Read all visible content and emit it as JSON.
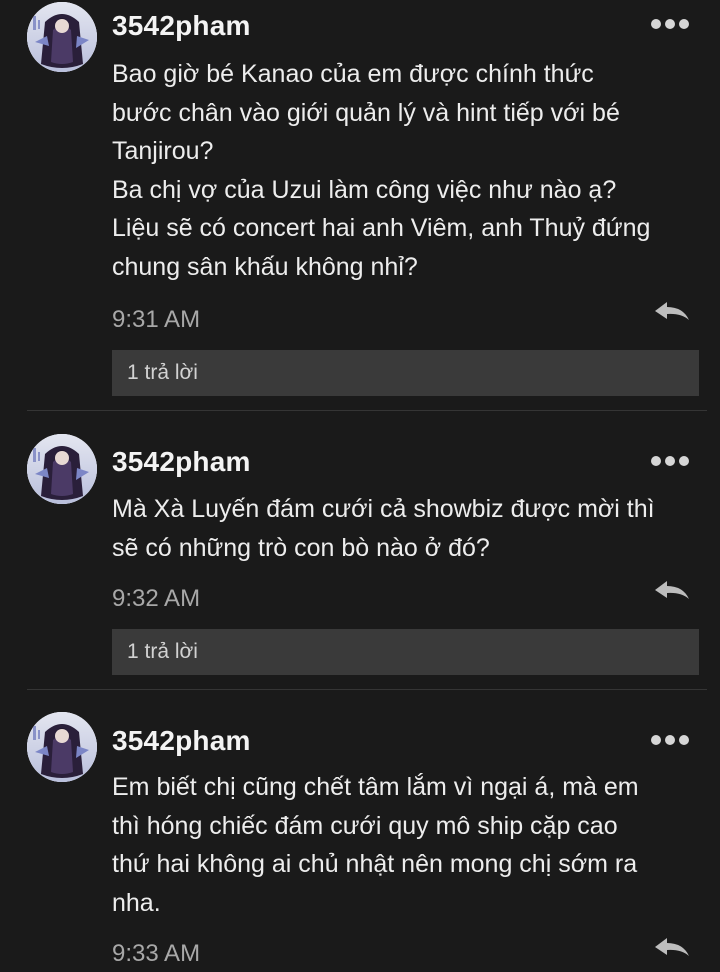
{
  "comments": [
    {
      "username": "3542pham",
      "lines": [
        "Bao giờ bé Kanao của em được chính thức",
        "bước chân vào giới quản lý và hint tiếp với bé",
        "Tanjirou?",
        "Ba chị vợ của Uzui làm công việc như nào ạ?",
        "Liệu sẽ có concert hai anh Viêm, anh Thuỷ đứng",
        "chung sân khấu không nhỉ?"
      ],
      "time": "9:31 AM",
      "replies_label": "1 trả lời"
    },
    {
      "username": "3542pham",
      "lines": [
        "Mà Xà Luyến đám cưới cả showbiz được mời thì",
        "sẽ có những trò con bò nào ở đó?"
      ],
      "time": "9:32 AM",
      "replies_label": "1 trả lời"
    },
    {
      "username": "3542pham",
      "lines": [
        "Em biết chị cũng chết tâm lắm vì ngại á, mà em",
        "thì hóng chiếc đám cưới quy mô ship cặp cao",
        "thứ hai không ai chủ nhật nên mong chị sớm ra",
        "nha."
      ],
      "time": "9:33 AM"
    }
  ],
  "icons": {
    "more": "more-options-icon",
    "reply": "reply-arrow-icon",
    "avatar": "user-avatar"
  },
  "colors": {
    "background": "#1a1a1a",
    "text": "#ededed",
    "time": "#a8a8a8",
    "replies_bg": "#3a3a3a",
    "divider": "#353535"
  }
}
